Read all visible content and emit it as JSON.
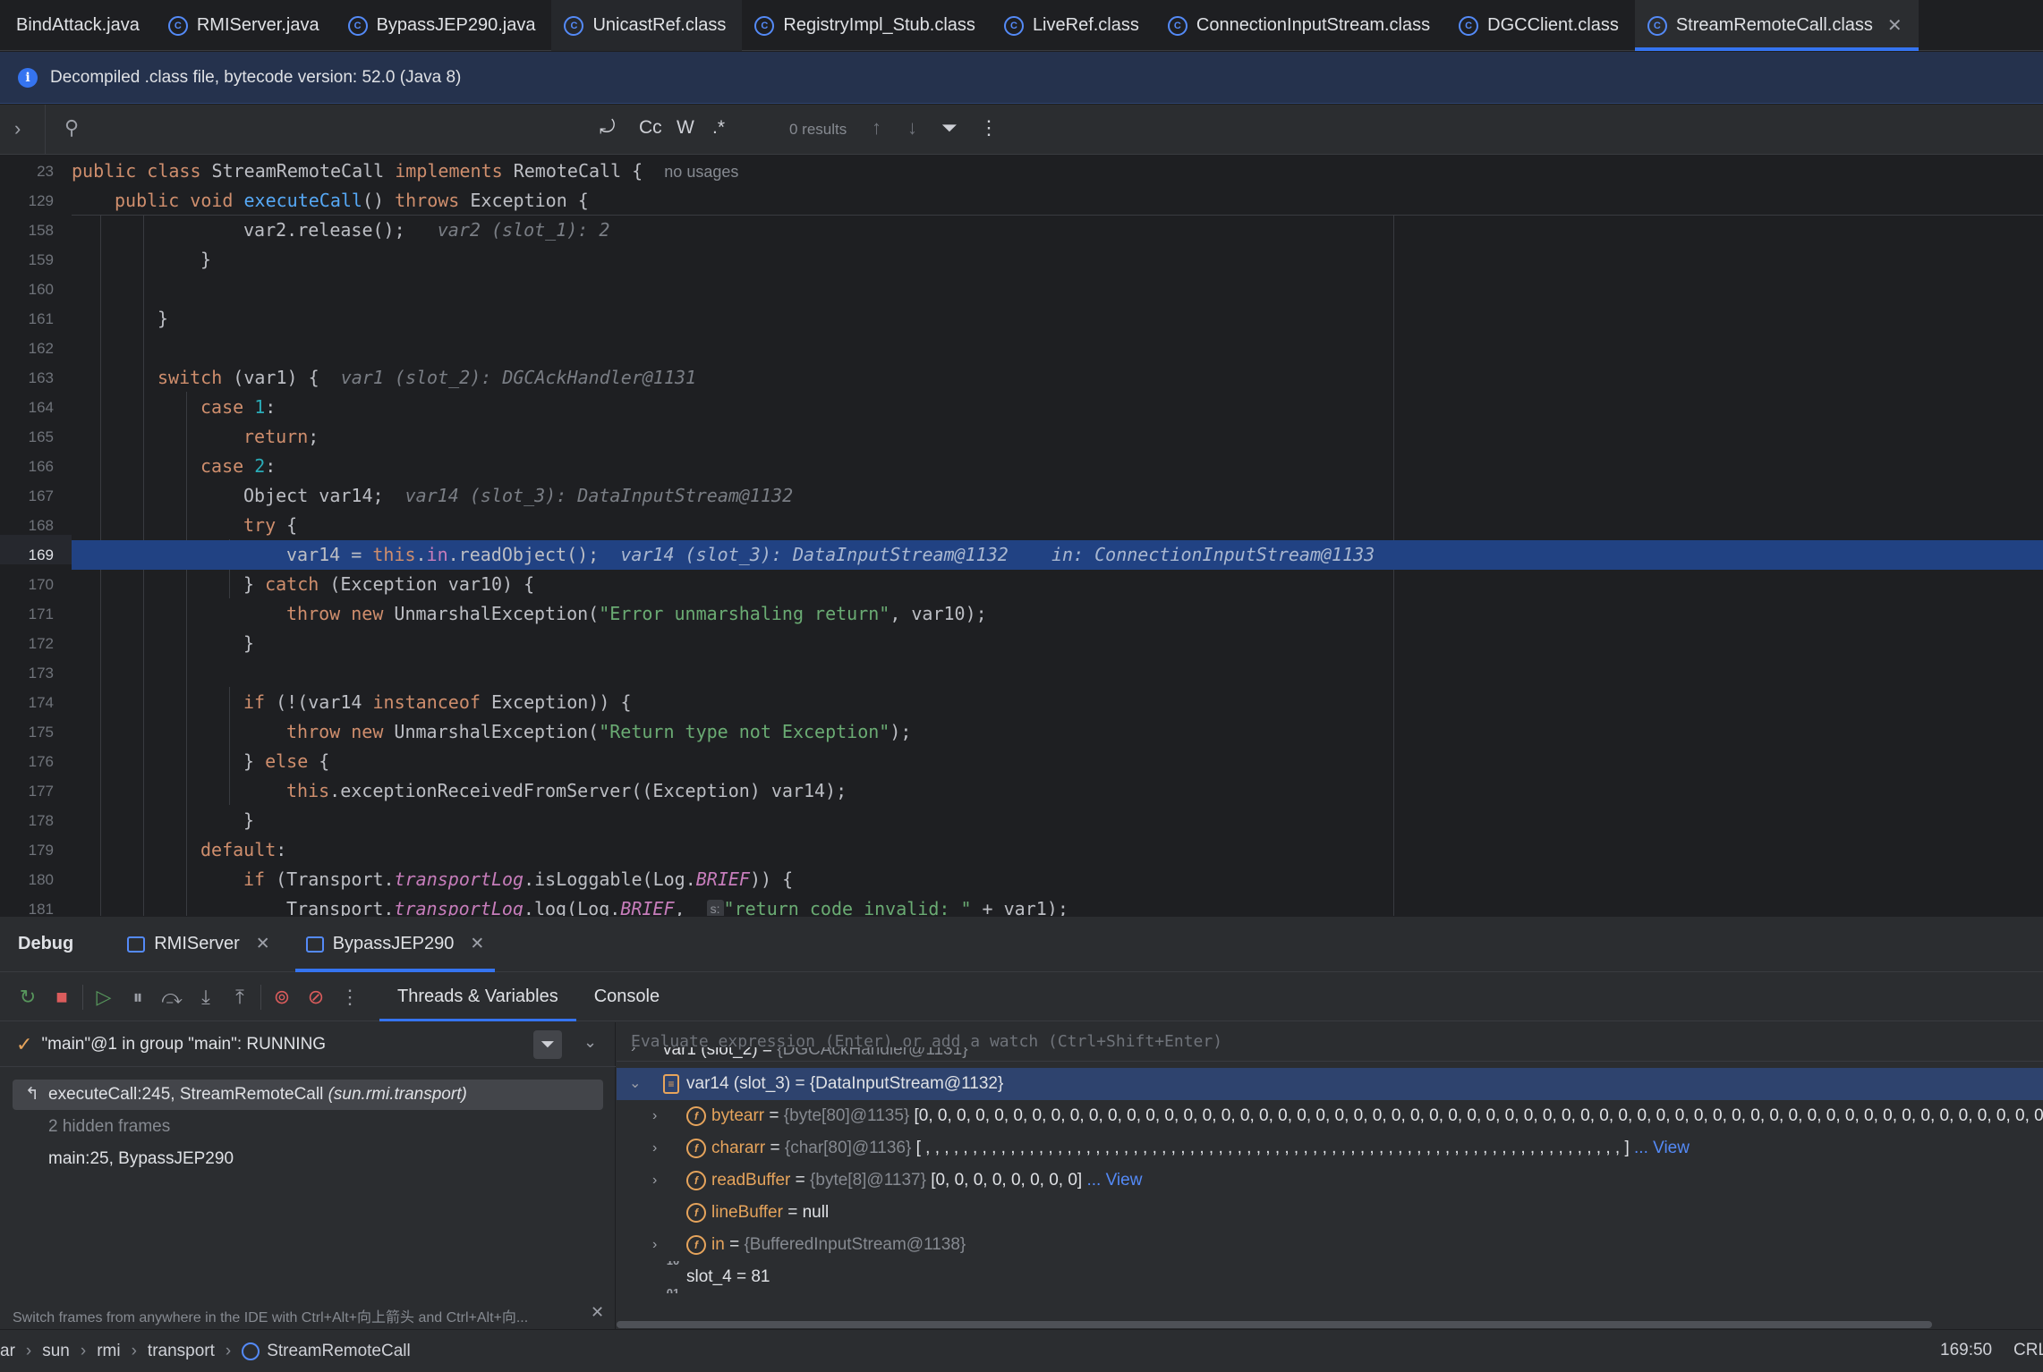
{
  "tabs": [
    {
      "label": "BindAttack.java",
      "icon": "java-file-icon",
      "active": false
    },
    {
      "label": "RMIServer.java",
      "icon": "java-class-icon",
      "active": false
    },
    {
      "label": "BypassJEP290.java",
      "icon": "java-class-icon",
      "active": false
    },
    {
      "label": "UnicastRef.class",
      "icon": "class-file-icon",
      "active": false
    },
    {
      "label": "RegistryImpl_Stub.class",
      "icon": "class-file-icon",
      "active": false
    },
    {
      "label": "LiveRef.class",
      "icon": "class-file-icon",
      "active": false
    },
    {
      "label": "ConnectionInputStream.class",
      "icon": "class-file-icon",
      "active": false
    },
    {
      "label": "DGCClient.class",
      "icon": "class-file-icon",
      "active": false
    },
    {
      "label": "StreamRemoteCall.class",
      "icon": "class-file-icon",
      "active": true
    }
  ],
  "banner": {
    "text": "Decompiled .class file, bytecode version: 52.0 (Java 8)"
  },
  "search": {
    "value": "",
    "btn_replace": "⤾",
    "btn_case": "Cc",
    "btn_word": "W",
    "btn_regex": ".*",
    "results": "0 results"
  },
  "editor": {
    "sticky": [
      {
        "num": "23",
        "text_a": "public class ",
        "text_b": "StreamRemoteCall ",
        "text_c": "implements ",
        "text_d": "RemoteCall {",
        "usage": "no usages"
      },
      {
        "num": "129",
        "text_a": "public void ",
        "fn": "executeCall",
        "text_b": "() ",
        "text_c": "throws ",
        "text_d": "Exception {"
      }
    ],
    "lines": {
      "l158": {
        "num": "158",
        "code": "var2.release();",
        "hint": "var2 (slot_1): 2"
      },
      "l159": {
        "num": "159",
        "code": "}"
      },
      "l160": {
        "num": "160"
      },
      "l161": {
        "num": "161",
        "code": "}"
      },
      "l162": {
        "num": "162"
      },
      "l163": {
        "num": "163",
        "kw": "switch",
        "code": " (var1) {",
        "hint": "var1 (slot_2): DGCAckHandler@1131"
      },
      "l164": {
        "num": "164",
        "kw": "case",
        "numv": "1",
        "code": ":"
      },
      "l165": {
        "num": "165",
        "kw": "return",
        "code": ";"
      },
      "l166": {
        "num": "166",
        "kw": "case",
        "numv": "2",
        "code": ":"
      },
      "l167": {
        "num": "167",
        "code": "Object var14;",
        "hint": "var14 (slot_3): DataInputStream@1132"
      },
      "l168": {
        "num": "168",
        "kw": "try",
        "code": " {"
      },
      "l169": {
        "num": "169",
        "a": "var14 = ",
        "kw": "this",
        "dot": ".",
        "fld": "in",
        "b": ".readObject();",
        "hint": "var14 (slot_3): DataInputStream@1132",
        "hint2": "in: ConnectionInputStream@1133"
      },
      "l170": {
        "num": "170",
        "a": "} ",
        "kw": "catch",
        "b": " (Exception var10) {"
      },
      "l171": {
        "num": "171",
        "kw": "throw new",
        "a": " UnmarshalException(",
        "str": "\"Error unmarshaling return\"",
        "b": ", var10);"
      },
      "l172": {
        "num": "172",
        "code": "}"
      },
      "l173": {
        "num": "173"
      },
      "l174": {
        "num": "174",
        "kw": "if",
        "a": " (!(var14 ",
        "kw2": "instanceof",
        "b": " Exception)) {"
      },
      "l175": {
        "num": "175",
        "kw": "throw new",
        "a": " UnmarshalException(",
        "str": "\"Return type not Exception\"",
        "b": ");"
      },
      "l176": {
        "num": "176",
        "a": "} ",
        "kw": "else",
        "b": " {"
      },
      "l177": {
        "num": "177",
        "kw": "this",
        "a": ".exceptionReceivedFromServer((Exception) var14);"
      },
      "l178": {
        "num": "178",
        "code": "}"
      },
      "l179": {
        "num": "179",
        "kw": "default",
        "code": ":"
      },
      "l180": {
        "num": "180",
        "kw": "if",
        "a": " (Transport.",
        "sfld": "transportLog",
        "b": ".isLoggable(Log.",
        "cnst": "BRIEF",
        "c": ")) {"
      },
      "l181": {
        "num": "181",
        "a": "Transport.",
        "sfld": "transportLog",
        "b": ".log(Log.",
        "cnst": "BRIEF",
        "c": ", ",
        "inlay": "s:",
        "str": "\"return code invalid: \"",
        "d": " + var1);"
      }
    }
  },
  "debug": {
    "title": "Debug",
    "sessions": [
      {
        "label": "RMIServer",
        "active": false
      },
      {
        "label": "BypassJEP290",
        "active": true
      }
    ],
    "subtabs": [
      {
        "label": "Threads & Variables",
        "active": true
      },
      {
        "label": "Console",
        "active": false
      }
    ],
    "thread": "\"main\"@1 in group \"main\": RUNNING",
    "frames": [
      {
        "label": "executeCall:245, StreamRemoteCall ",
        "pkg": "(sun.rmi.transport)",
        "selected": true
      },
      {
        "label": "2 hidden frames",
        "hidden": true
      },
      {
        "label": "main:25, BypassJEP290"
      }
    ],
    "frames_hint": "Switch frames from anywhere in the IDE with Ctrl+Alt+向上箭头 and Ctrl+Alt+向...",
    "eval_placeholder": "Evaluate expression (Enter) or add a watch (Ctrl+Shift+Enter)",
    "vars": [
      {
        "name": "var1 (slot_2)",
        "eq": " = ",
        "type": "{DGCAckHandler@1131}"
      },
      {
        "name": "var14 (slot_3)",
        "eq": " = ",
        "val": "{DataInputStream@1132}"
      },
      {
        "name": "bytearr",
        "eq": " = ",
        "type": "{byte[80]@1135} ",
        "val": "[0, 0, 0, 0, 0, 0, 0, 0, 0, 0, 0, 0, 0, 0, 0, 0, 0, 0, 0, 0, 0, 0, 0, 0, 0, 0, 0, 0, 0, 0, 0, 0, 0, 0, 0, 0, 0, 0, 0, 0, 0, 0, 0, 0, 0, 0, 0, 0, 0, 0, 0, 0, 0, 0, 0, 0, 0, 0, 0, 0, 0, 0, 0, 0, 0, 0, 0, 0, 0, 0,"
      },
      {
        "name": "chararr",
        "eq": " = ",
        "type": "{char[80]@1136} ",
        "val": "[ , , , , , , , , , , , , , , , , , , , , , , , , , , , , , , , , , , , , , , , , , , , , , , , , , , , , , , , , , , , , , , , , , , , , , , , , , , ]",
        "link": " ... View"
      },
      {
        "name": "readBuffer",
        "eq": " = ",
        "type": "{byte[8]@1137} ",
        "val": "[0, 0, 0, 0, 0, 0, 0, 0]",
        "link": " ... View"
      },
      {
        "name": "lineBuffer",
        "eq": " = ",
        "val": "null"
      },
      {
        "name": "in",
        "eq": " = ",
        "type": "{BufferedInputStream@1138}"
      },
      {
        "name": "slot_4",
        "eq": " = ",
        "val": "81"
      }
    ]
  },
  "status": {
    "crumbs": [
      "ar",
      "sun",
      "rmi",
      "transport",
      "StreamRemoteCall"
    ],
    "position": "169:50",
    "line_sep": "CRL"
  }
}
